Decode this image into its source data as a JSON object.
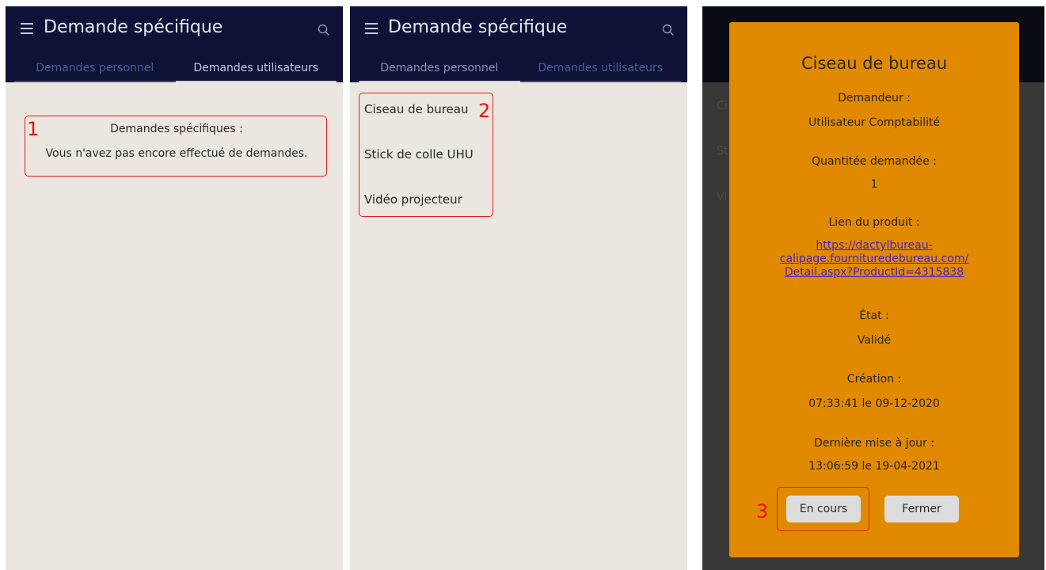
{
  "app": {
    "title": "Demande spécifique",
    "tabs": [
      "Demandes personnel",
      "Demandes utilisateurs"
    ]
  },
  "panel1": {
    "empty_title": "Demandes spécifiques :",
    "empty_message": "Vous n'avez pas encore effectué de demandes.",
    "marker": "1"
  },
  "panel2": {
    "items": [
      "Ciseau de bureau",
      "Stick de colle UHU",
      "Vidéo projecteur"
    ],
    "marker": "2"
  },
  "panel3": {
    "ghost_letters": [
      "Ci",
      "St",
      "Vi"
    ],
    "dialog": {
      "title": "Ciseau de bureau",
      "requester_label": "Demandeur :",
      "requester_value": "Utilisateur Comptabilité",
      "quantity_label": "Quantitée demandée :",
      "quantity_value": "1",
      "link_label": "Lien du produit :",
      "link_lines": [
        "https://dactylbureau-",
        "calipage.fournituredebureau.com/",
        "Detail.aspx?ProductId=4315838"
      ],
      "state_label": "État :",
      "state_value": "Validé",
      "created_label": "Création :",
      "created_value": "07:33:41 le 09-12-2020",
      "updated_label": "Dernière mise à jour :",
      "updated_value": "13:06:59 le 19-04-2021",
      "btn_in_progress": "En cours",
      "btn_close": "Fermer"
    },
    "marker": "3"
  },
  "colors": {
    "appbar": "#0d1236",
    "body": "#ebe6df",
    "dialog": "#e18a00",
    "annotation": "#e02020",
    "link": "#4a1fc4"
  }
}
